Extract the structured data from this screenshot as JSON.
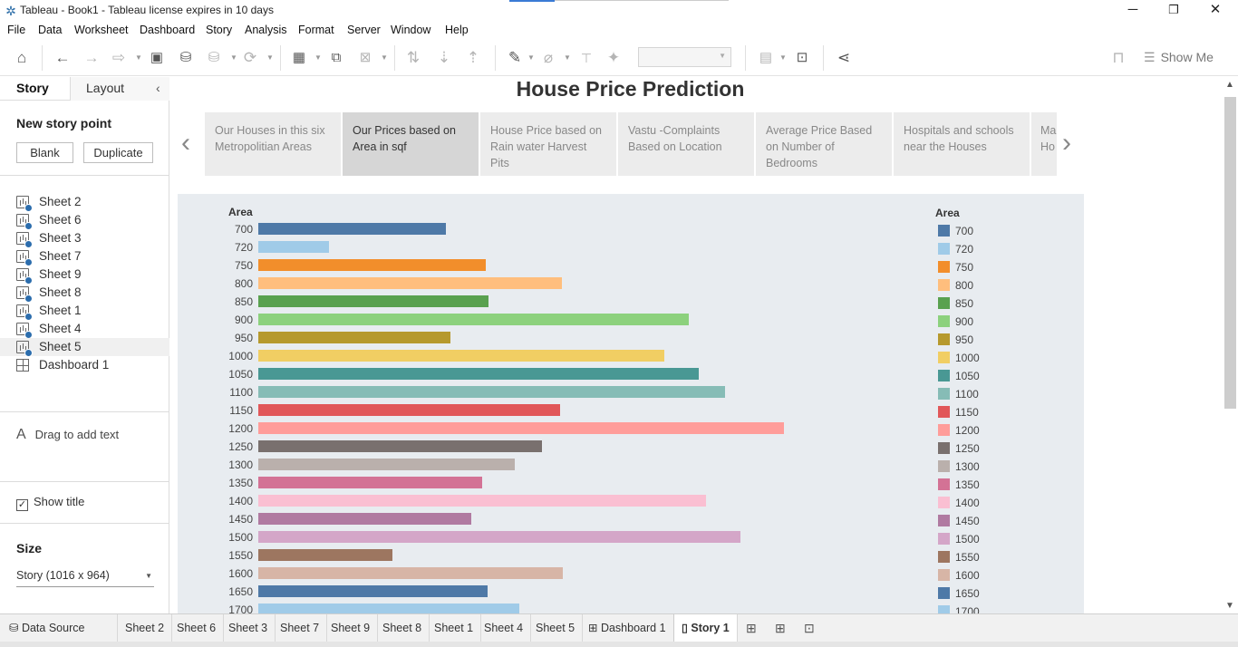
{
  "window": {
    "title": "Tableau - Book1 - Tableau license expires in 10 days",
    "minimize": "─",
    "maximize": "❐",
    "close": "✕"
  },
  "menu": [
    "File",
    "Data",
    "Worksheet",
    "Dashboard",
    "Story",
    "Analysis",
    "Format",
    "Server",
    "Window",
    "Help"
  ],
  "toolbar": {
    "show_me_label": "Show Me",
    "icons": [
      "home-icon",
      "undo-icon",
      "redo-icon",
      "replay-icon",
      "save-icon",
      "new-datasource-icon",
      "pause-icon",
      "refresh-icon",
      "new-worksheet-icon",
      "duplicate-icon",
      "clear-icon",
      "swap-icon",
      "sort-asc-icon",
      "sort-desc-icon",
      "highlight-icon",
      "group-icon",
      "label-icon",
      "pin-icon",
      "fit-dropdown",
      "card-icon",
      "presentation-icon",
      "share-icon"
    ]
  },
  "left_panel": {
    "tab_story": "Story",
    "tab_layout": "Layout",
    "collapse": "‹",
    "new_story_point": "New story point",
    "blank_button": "Blank",
    "duplicate_button": "Duplicate",
    "sheets": [
      {
        "label": "Sheet 2",
        "type": "sheet"
      },
      {
        "label": "Sheet 6",
        "type": "sheet"
      },
      {
        "label": "Sheet 3",
        "type": "sheet"
      },
      {
        "label": "Sheet 7",
        "type": "sheet"
      },
      {
        "label": "Sheet 9",
        "type": "sheet"
      },
      {
        "label": "Sheet 8",
        "type": "sheet"
      },
      {
        "label": "Sheet 1",
        "type": "sheet"
      },
      {
        "label": "Sheet 4",
        "type": "sheet"
      },
      {
        "label": "Sheet 5",
        "type": "sheet"
      },
      {
        "label": "Dashboard 1",
        "type": "dashboard"
      }
    ],
    "drag_text": "Drag to add text",
    "drag_glyph": "A",
    "show_title": "Show title",
    "size_label": "Size",
    "size_value": "Story (1016 x 964)"
  },
  "story": {
    "title": "House Price Prediction",
    "points": [
      "Our Houses in this six Metropolitian Areas",
      "Our Prices based on Area in sqf",
      "House Price based on Rain water Harvest Pits",
      "Vastu -Complaints Based on Location",
      "Average Price Based on Number of Bedrooms",
      "Hospitals and schools near the Houses",
      "Ma Ho"
    ],
    "active_point": 1
  },
  "chart_data": {
    "type": "bar",
    "orientation": "horizontal",
    "title": "",
    "ylabel": "Area",
    "xlabel": "",
    "legend_title": "Area",
    "legend_position": "right",
    "grid": false,
    "categories": [
      "700",
      "720",
      "750",
      "800",
      "850",
      "900",
      "950",
      "1000",
      "1050",
      "1100",
      "1150",
      "1200",
      "1250",
      "1300",
      "1350",
      "1400",
      "1450",
      "1500",
      "1550",
      "1600",
      "1650",
      "1700"
    ],
    "values": [
      207,
      78,
      251,
      335,
      254,
      475,
      212,
      448,
      486,
      515,
      333,
      580,
      313,
      283,
      247,
      494,
      235,
      532,
      148,
      336,
      253,
      288
    ],
    "colors": [
      "#4e79a7",
      "#a0cbe8",
      "#f28e2b",
      "#ffbe7d",
      "#59a14f",
      "#8cd17d",
      "#b6992d",
      "#f1ce63",
      "#499894",
      "#86bcb6",
      "#e15759",
      "#ff9d9a",
      "#79706e",
      "#bab0ac",
      "#d37295",
      "#fabfd2",
      "#b07aa1",
      "#d4a6c8",
      "#9d7660",
      "#d7b5a6",
      "#4e79a7",
      "#a0cbe8"
    ]
  },
  "bottom_tabs": {
    "data_source": "Data Source",
    "tabs": [
      "Sheet 2",
      "Sheet 6",
      "Sheet 3",
      "Sheet 7",
      "Sheet 9",
      "Sheet 8",
      "Sheet 1",
      "Sheet 4",
      "Sheet 5",
      "Dashboard 1",
      "Story 1"
    ],
    "active": "Story 1"
  }
}
